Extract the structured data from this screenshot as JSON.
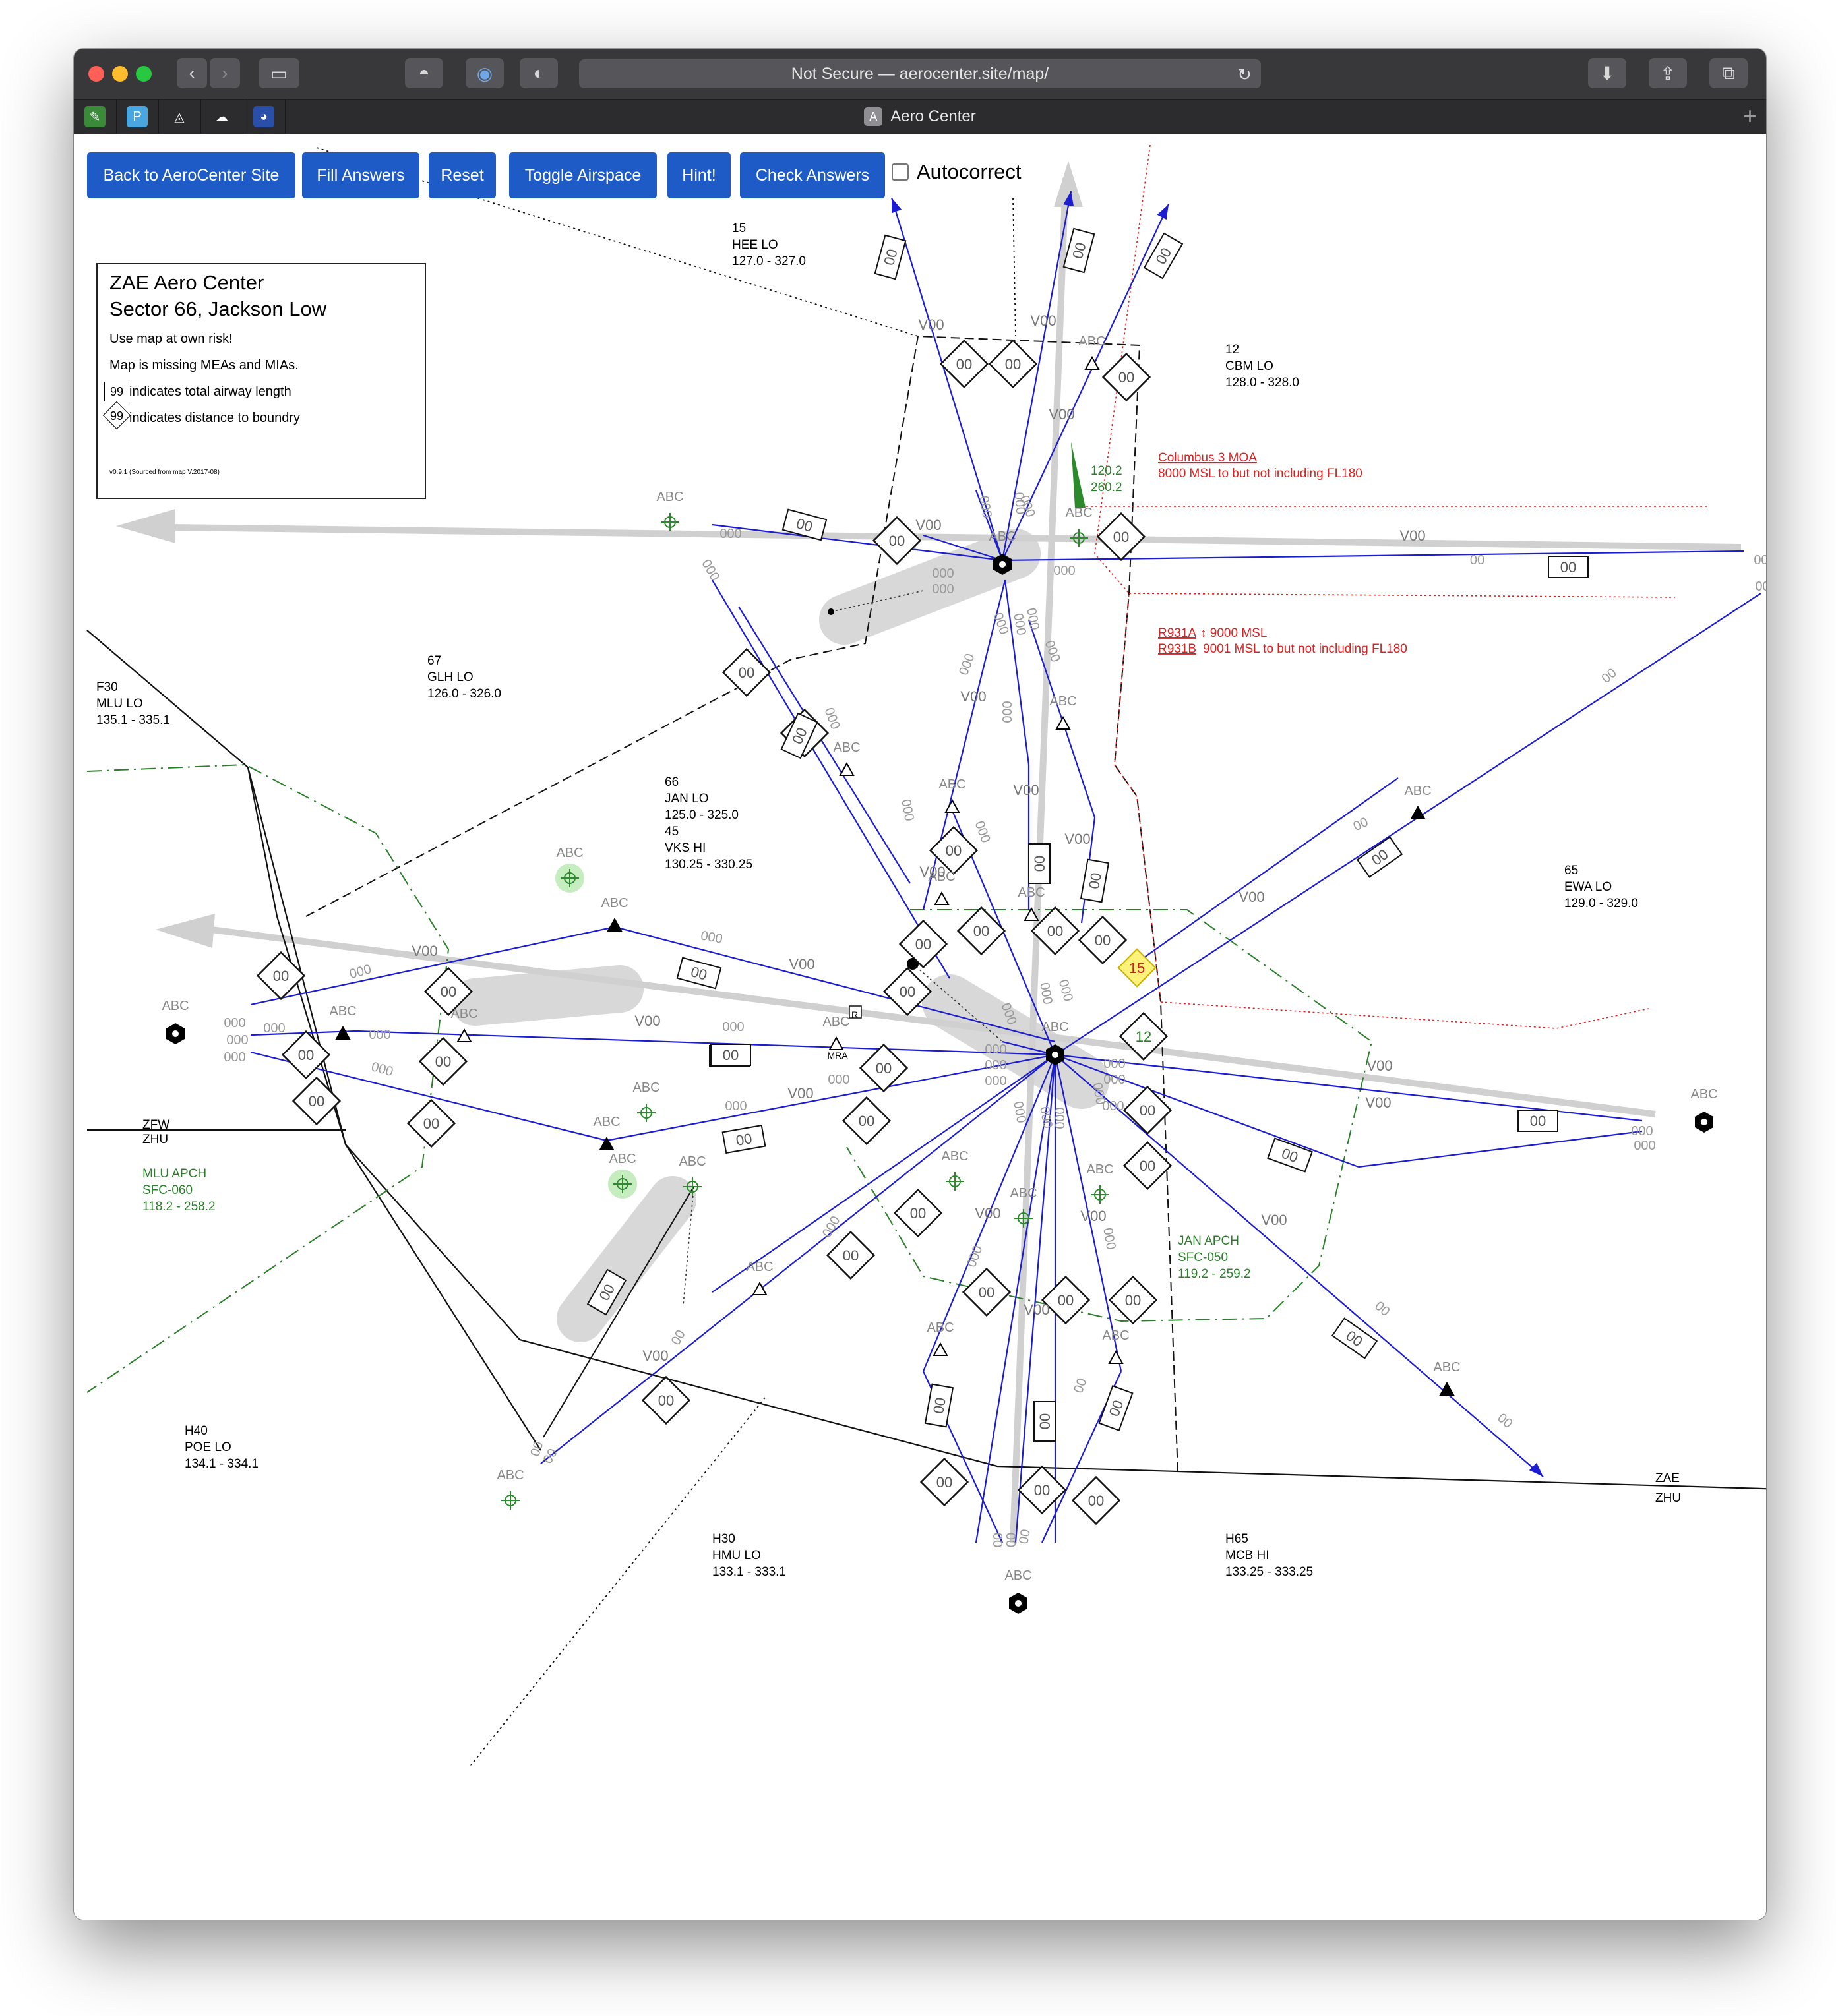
{
  "browser": {
    "url": "Not Secure — aerocenter.site/map/",
    "tab_title": "Aero Center",
    "tab_icon_letter": "A"
  },
  "toolbar": {
    "back_label": "Back to AeroCenter Site",
    "fill_label": "Fill Answers",
    "reset_label": "Reset",
    "toggle_label": "Toggle Airspace",
    "hint_label": "Hint!",
    "check_label": "Check Answers",
    "autocorrect_label": "Autocorrect",
    "autocorrect_checked": false
  },
  "legend": {
    "title": "ZAE Aero Center",
    "subtitle": "Sector 66, Jackson Low",
    "line1": "Use map at own risk!",
    "line2": "Map is missing MEAs and MIAs.",
    "sample_num": "99",
    "line3": "indicates total airway length",
    "line4": "indicates distance to boundry",
    "version": "v0.9.1 (Sourced from map V.2017-08)"
  },
  "sectors": [
    {
      "lines": [
        "15",
        "HEE LO",
        "127.0 - 327.0"
      ]
    },
    {
      "lines": [
        "12",
        "CBM LO",
        "128.0 - 328.0"
      ]
    },
    {
      "lines": [
        "67",
        "GLH LO",
        "126.0 - 326.0"
      ]
    },
    {
      "lines": [
        "F30",
        "MLU LO",
        "135.1 - 335.1"
      ]
    },
    {
      "lines": [
        "66",
        "JAN LO",
        "125.0 - 325.0",
        "45",
        "VKS HI",
        "130.25 - 330.25"
      ]
    },
    {
      "lines": [
        "65",
        "EWA LO",
        "129.0 - 329.0"
      ]
    },
    {
      "lines": [
        "H40",
        "POE LO",
        "134.1 - 334.1"
      ]
    },
    {
      "lines": [
        "H30",
        "HMU LO",
        "133.1 - 333.1"
      ]
    },
    {
      "lines": [
        "H65",
        "MCB HI",
        "133.25 - 333.25"
      ]
    }
  ],
  "boundary_labels": {
    "zfw": "ZFW",
    "zhu_left": "ZHU",
    "zae": "ZAE",
    "zhu_right": "ZHU"
  },
  "approach": {
    "mlu": [
      "MLU APCH",
      "SFC-060",
      "118.2 - 258.2"
    ],
    "jan": [
      "JAN APCH",
      "SFC-050",
      "119.2 - 259.2"
    ],
    "freq": [
      "120.2",
      "260.2"
    ]
  },
  "special_use": {
    "moa_name": "Columbus 3 MOA",
    "moa_alt": "8000 MSL to but not including FL180",
    "r931a": "R931A",
    "r931a_alt": "↕ 9000 MSL",
    "r931b": "R931B",
    "r931b_alt": "9001 MSL to but not including FL180"
  },
  "map_tokens": {
    "fix": "ABC",
    "airway": "V00",
    "dist": "00",
    "rad": "000",
    "mra": "MRA",
    "r": "R",
    "hl15": "15",
    "hl12": "12"
  },
  "colors": {
    "airway": "#1c1cd0",
    "moa": "#e02020",
    "apch": "#1e7a1e",
    "button": "#1e5bc7"
  }
}
